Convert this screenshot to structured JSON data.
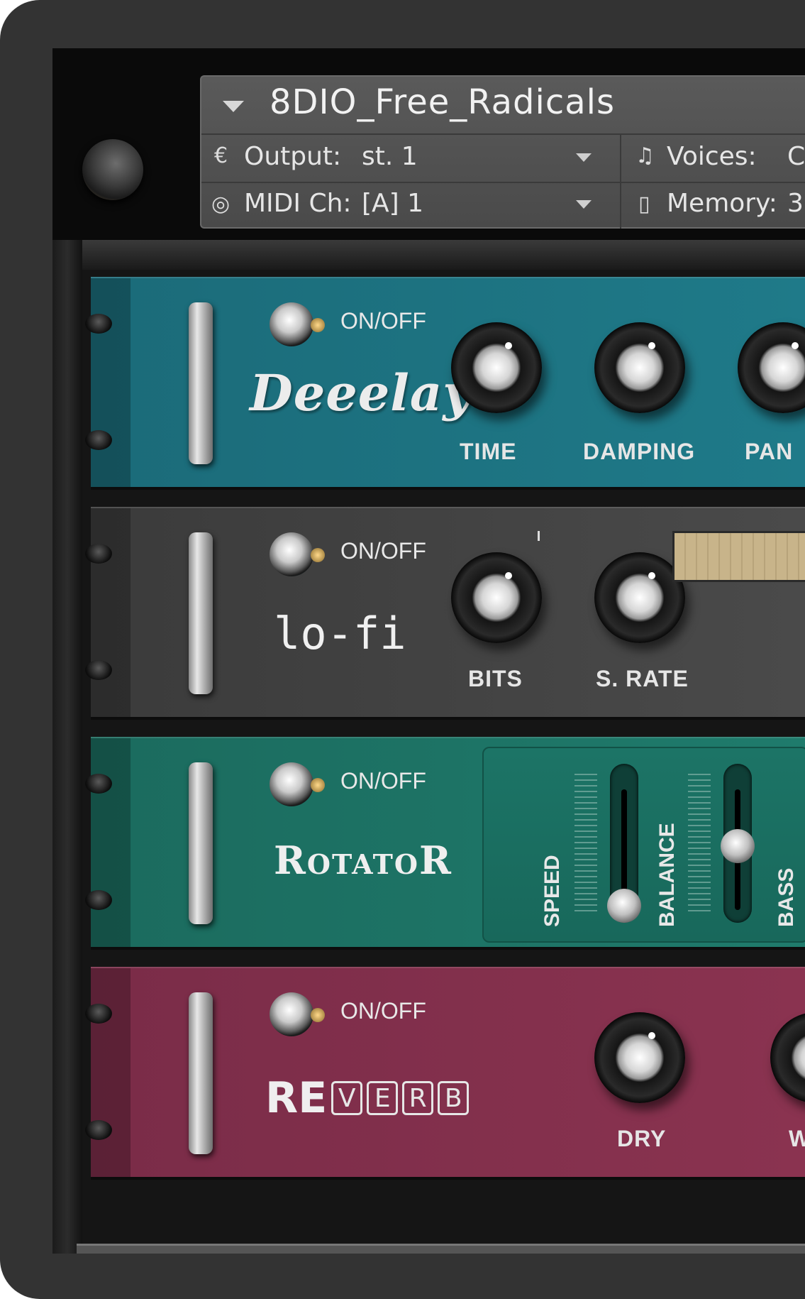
{
  "instrument": {
    "name": "8DIO_Free_Radicals",
    "output_label": "Output:",
    "output_value": "st. 1",
    "midi_label": "MIDI Ch:",
    "midi_value": "[A]  1",
    "voices_label": "Voices:",
    "voices_value": "C",
    "memory_label": "Memory:",
    "memory_value": "3"
  },
  "icons": {
    "output": "output-icon",
    "midi": "midi-icon",
    "voices": "voices-icon",
    "memory": "memory-icon"
  },
  "effects": [
    {
      "name": "Deeelay",
      "onoff": "ON/OFF",
      "controls": [
        "TIME",
        "DAMPING",
        "PAN"
      ],
      "color": "#1f7a89"
    },
    {
      "name": "lo-fi",
      "onoff": "ON/OFF",
      "controls": [
        "BITS",
        "S. RATE"
      ],
      "color": "#444444"
    },
    {
      "name": "RotatoR",
      "onoff": "ON/OFF",
      "controls": [
        "SPEED",
        "BALANCE",
        "BASS"
      ],
      "color": "#1f7b6c"
    },
    {
      "name_prefix": "RE",
      "name_letters": [
        "V",
        "E",
        "R",
        "B"
      ],
      "onoff": "ON/OFF",
      "controls": [
        "DRY",
        "W"
      ],
      "color": "#8a3350"
    }
  ]
}
